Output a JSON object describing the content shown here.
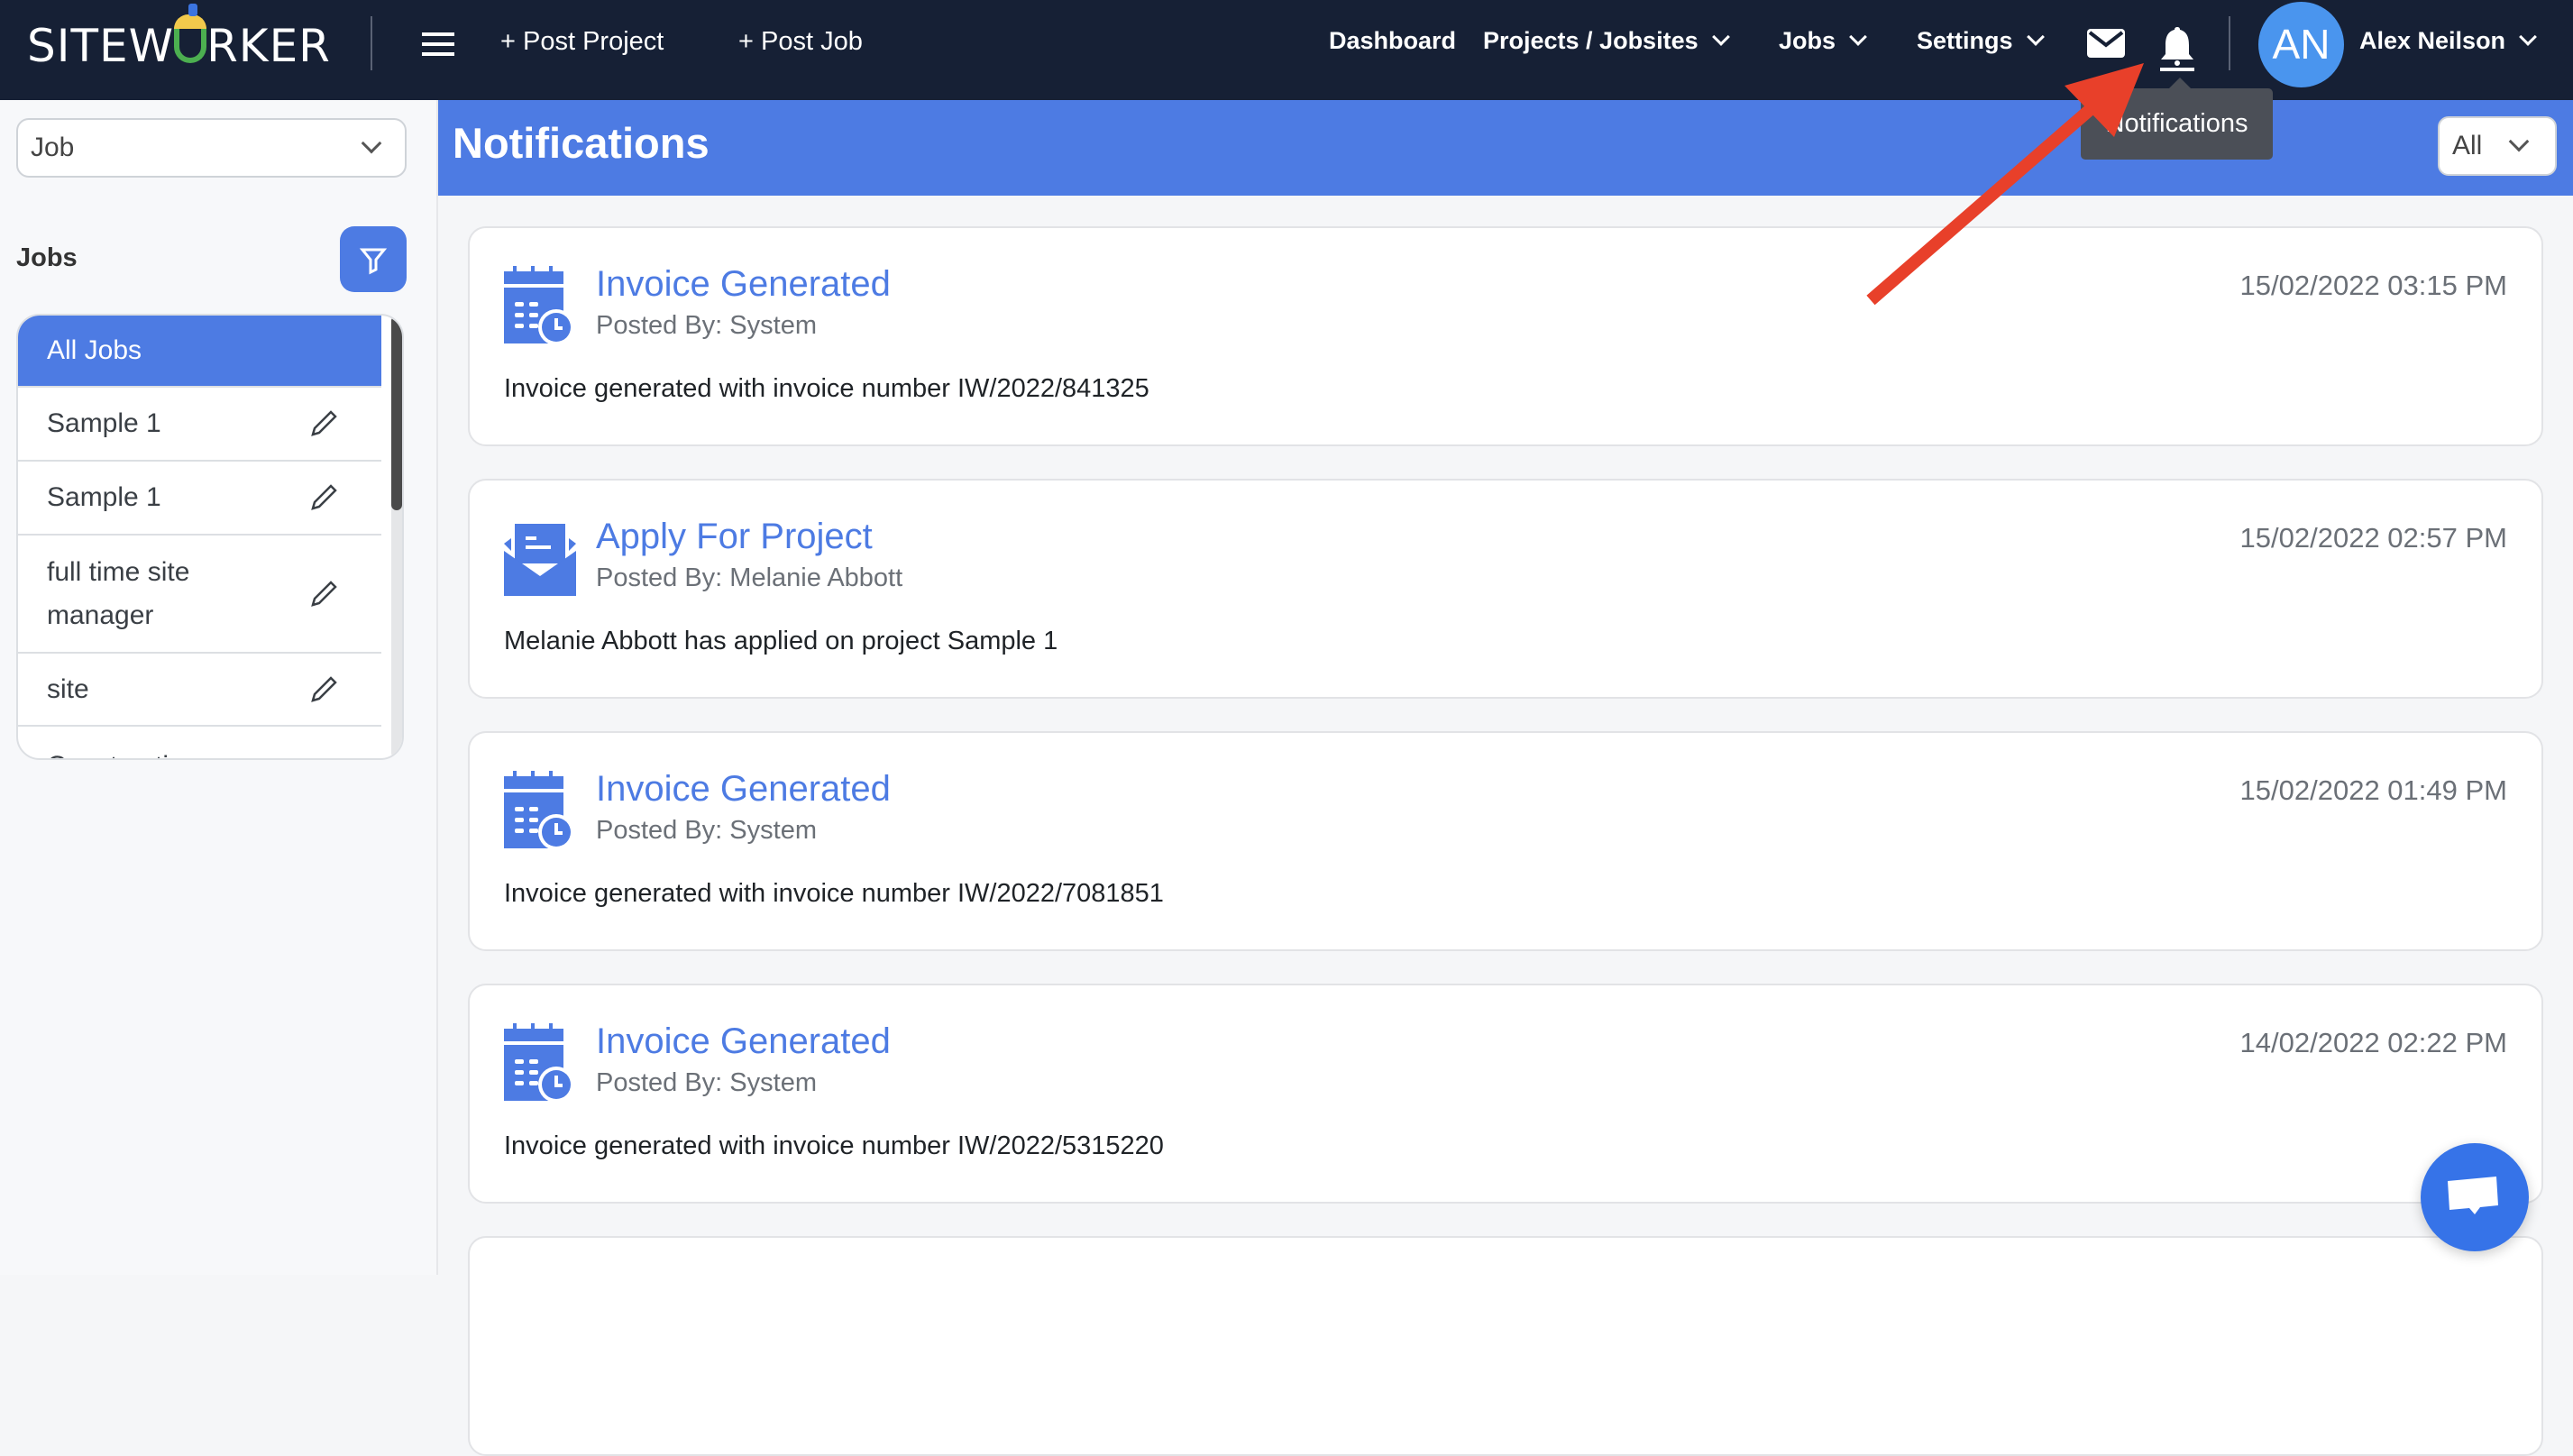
{
  "header": {
    "logo": "SITEWORKER",
    "post_project": "+ Post Project",
    "post_job": "+ Post Job",
    "nav": [
      {
        "label": "Dashboard"
      },
      {
        "label": "Projects / Jobsites"
      },
      {
        "label": "Jobs"
      },
      {
        "label": "Settings"
      }
    ],
    "avatar_initials": "AN",
    "user_name": "Alex Neilson",
    "tooltip": "Notifications"
  },
  "sidebar": {
    "type_select": "Job",
    "jobs_label": "Jobs",
    "jobs": [
      {
        "label": "All Jobs",
        "active": true
      },
      {
        "label": "Sample 1"
      },
      {
        "label": "Sample 1"
      },
      {
        "label": "full time site manager"
      },
      {
        "label": "site"
      },
      {
        "label": "Construction"
      }
    ]
  },
  "main": {
    "title": "Notifications",
    "filter_select": "All",
    "notifications": [
      {
        "icon": "calendar-clock-icon",
        "title": "Invoice Generated",
        "posted_by": "Posted By: System",
        "body": "Invoice generated with invoice number IW/2022/841325",
        "date": "15/02/2022 03:15 PM"
      },
      {
        "icon": "open-envelope-icon",
        "title": "Apply For Project",
        "posted_by": "Posted By: Melanie Abbott",
        "body": "Melanie Abbott has applied on project Sample 1",
        "date": "15/02/2022 02:57 PM"
      },
      {
        "icon": "calendar-clock-icon",
        "title": "Invoice Generated",
        "posted_by": "Posted By: System",
        "body": "Invoice generated with invoice number IW/2022/7081851",
        "date": "15/02/2022 01:49 PM"
      },
      {
        "icon": "calendar-clock-icon",
        "title": "Invoice Generated",
        "posted_by": "Posted By: System",
        "body": "Invoice generated with invoice number IW/2022/5315220",
        "date": "14/02/2022 02:22 PM"
      }
    ]
  },
  "colors": {
    "header_bg": "#162035",
    "accent": "#4d7be3",
    "chat": "#3673e8",
    "annotation_arrow": "#e8402a"
  }
}
